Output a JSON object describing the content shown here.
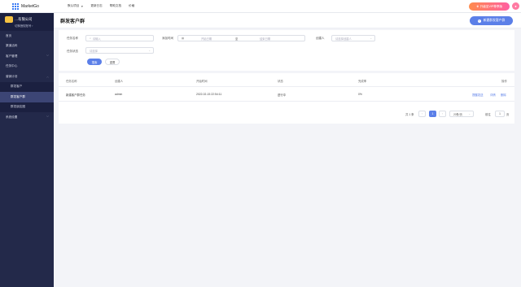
{
  "header": {
    "logo_text": "MarketGo",
    "nav": [
      {
        "label": "默认项目",
        "has_caret": true
      },
      {
        "label": "更新日志",
        "has_caret": false
      },
      {
        "label": "帮助文档",
        "has_caret": false
      },
      {
        "label": "价格",
        "has_caret": false
      }
    ],
    "upgrade_label": "升级至VIP尊享版",
    "upgrade_icon": "crown-icon",
    "avatar_icon": "user-icon"
  },
  "sidebar": {
    "company_name": "…有限公司",
    "company_sub": "切换授权账号 ›",
    "items": [
      {
        "label": "首页",
        "chevron": false
      },
      {
        "label": "渠道活码",
        "chevron": false
      },
      {
        "label": "客户管理",
        "chevron": true
      },
      {
        "label": "任务中心",
        "chevron": false
      },
      {
        "label": "营销计划",
        "chevron": true
      }
    ],
    "subitems": [
      {
        "label": "群发客户",
        "active": false
      },
      {
        "label": "群发客户群",
        "active": true
      },
      {
        "label": "群发朋友圈",
        "active": false
      }
    ],
    "last_item": {
      "label": "系统设置",
      "chevron": true
    }
  },
  "page": {
    "title": "群发客户群",
    "create_button": "新建群发客户群"
  },
  "filters": {
    "task_name_label": "任务名称",
    "task_name_placeholder": "请输入",
    "time_label": "添加时间",
    "start_placeholder": "开始日期",
    "range_sep": "至",
    "end_placeholder": "结束日期",
    "creator_label": "创建人",
    "creator_placeholder": "请选择创建人",
    "status_label": "任务状态",
    "status_placeholder": "请选择",
    "search_button": "搜索",
    "reset_button": "重置"
  },
  "table": {
    "columns": [
      "任务名称",
      "创建人",
      "开始时间",
      "状态",
      "完成率",
      "操作"
    ],
    "rows": [
      {
        "name": "新建客户群任务",
        "creator": "admin",
        "start": "2022-02-15 22:54:11",
        "status": "进行中",
        "rate": "0%",
        "ops": [
          "提醒发送",
          "详情",
          "删除"
        ]
      }
    ]
  },
  "pagination": {
    "total": "共 1 条",
    "prev": "‹",
    "current": "1",
    "next": "›",
    "page_size": "20条/页",
    "goto_label": "前往",
    "goto_value": "1",
    "page_suffix": "页"
  },
  "colors": {
    "sidebar_bg": "#23294a",
    "primary": "#5b7fe8",
    "upgrade_gradient_start": "#ff8b4c",
    "upgrade_gradient_end": "#ff5fa2"
  }
}
